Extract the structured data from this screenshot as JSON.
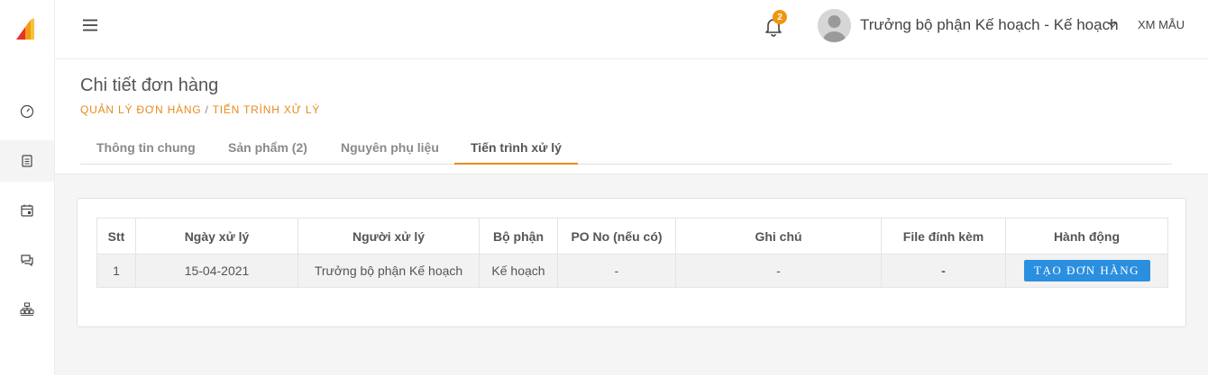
{
  "header": {
    "notification_count": "2",
    "user_name": "Trưởng bộ phận Kế hoạch - Kế hoạch",
    "company": "XM MẪU"
  },
  "sidebar": {
    "items": [
      {
        "icon": "dashboard-icon",
        "active": false
      },
      {
        "icon": "orders-icon",
        "active": true
      },
      {
        "icon": "calendar-icon",
        "active": false
      },
      {
        "icon": "chat-icon",
        "active": false
      },
      {
        "icon": "org-chart-icon",
        "active": false
      }
    ]
  },
  "page": {
    "title": "Chi tiết đơn hàng",
    "breadcrumb": [
      "QUẢN LÝ ĐƠN HÀNG",
      "TIẾN TRÌNH XỬ LÝ"
    ],
    "breadcrumb_sep": "/"
  },
  "tabs": [
    {
      "label": "Thông tin chung",
      "active": false
    },
    {
      "label": "Sản phẩm (2)",
      "active": false
    },
    {
      "label": "Nguyên phụ liệu",
      "active": false
    },
    {
      "label": "Tiến trình xử lý",
      "active": true
    }
  ],
  "table": {
    "columns": [
      "Stt",
      "Ngày xử lý",
      "Người xử lý",
      "Bộ phận",
      "PO No (nếu có)",
      "Ghi chú",
      "File đính kèm",
      "Hành động"
    ],
    "rows": [
      {
        "stt": "1",
        "date": "15-04-2021",
        "handler": "Trưởng bộ phận Kế hoạch",
        "department": "Kế hoạch",
        "po_no": "-",
        "note": "-",
        "attachment": "-",
        "action_label": "TẠO ĐƠN HÀNG"
      }
    ]
  },
  "colors": {
    "accent": "#e8891c",
    "primary_button": "#2b8fe0",
    "badge": "#f0960e"
  }
}
